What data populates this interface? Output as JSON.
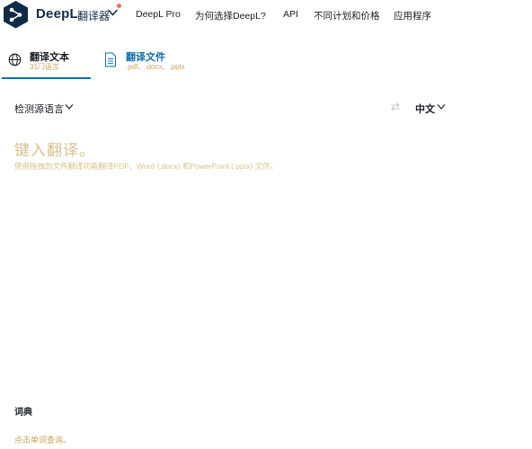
{
  "header": {
    "brand": "DeepL",
    "brand_sub": "翻译器",
    "nav": [
      "DeepL Pro",
      "为何选择DeepL?",
      "API",
      "不同计划和价格",
      "应用程序"
    ]
  },
  "tabs": {
    "text": {
      "title": "翻译文本",
      "sub": "31门语言"
    },
    "document": {
      "title": "翻译文件",
      "sub": ".pdf、.docx、.pptx"
    }
  },
  "languages": {
    "source": "检测源语言",
    "target": "中文"
  },
  "input": {
    "placeholder": "键入翻译。",
    "hint": "使用拖拽的文件翻译功能翻译PDF、Word (.docx) 和PowerPoint (.pptx) 文件。"
  },
  "dictionary": {
    "title": "词典",
    "hint": "点击单词查询。"
  },
  "colors": {
    "brand": "#0f2b46",
    "accent": "#0f6fa8",
    "placeholder": "#d7c28a",
    "notification": "#f26b4f"
  }
}
